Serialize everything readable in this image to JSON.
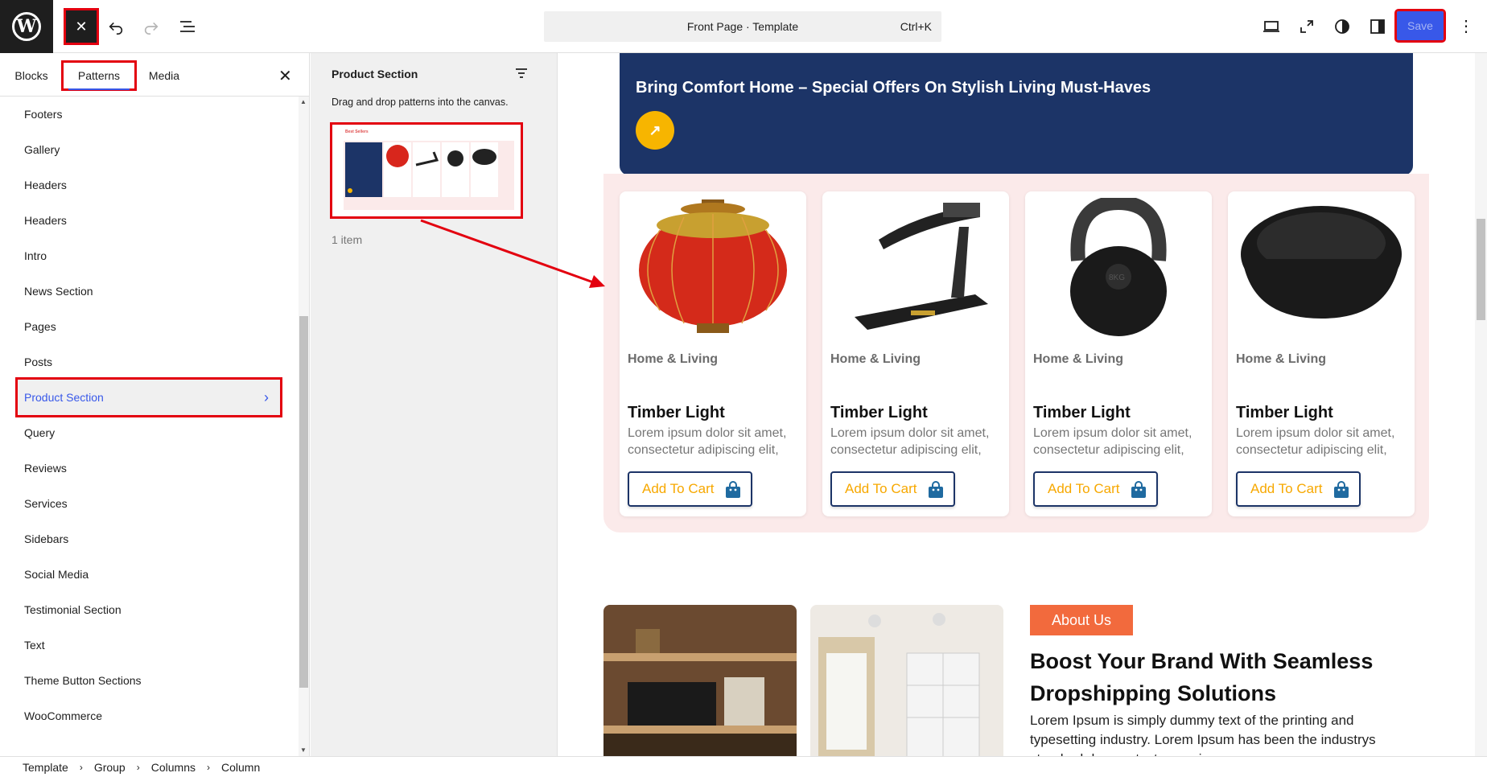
{
  "topbar": {
    "doc_title": "Front Page · Template",
    "shortcut": "Ctrl+K",
    "save_label": "Save",
    "icons": [
      "wordpress-icon",
      "close-icon",
      "undo-icon",
      "redo-icon",
      "list-view-icon",
      "desktop-icon",
      "fullscreen-icon",
      "styles-icon",
      "sidebar-icon",
      "more-icon"
    ]
  },
  "inserter": {
    "tabs": [
      {
        "label": "Blocks"
      },
      {
        "label": "Patterns"
      },
      {
        "label": "Media"
      }
    ],
    "active_tab": "Patterns",
    "categories": [
      {
        "label": "Footers"
      },
      {
        "label": "Gallery"
      },
      {
        "label": "Headers"
      },
      {
        "label": "Headers"
      },
      {
        "label": "Intro"
      },
      {
        "label": "News Section"
      },
      {
        "label": "Pages"
      },
      {
        "label": "Posts"
      },
      {
        "label": "Product Section"
      },
      {
        "label": "Query"
      },
      {
        "label": "Reviews"
      },
      {
        "label": "Services"
      },
      {
        "label": "Sidebars"
      },
      {
        "label": "Social Media"
      },
      {
        "label": "Testimonial Section"
      },
      {
        "label": "Text"
      },
      {
        "label": "Theme Button Sections"
      },
      {
        "label": "WooCommerce"
      }
    ],
    "selected_category": "Product Section"
  },
  "patterns": {
    "title": "Product Section",
    "description": "Drag and drop patterns into the canvas.",
    "count": "1 item"
  },
  "canvas": {
    "banner_title": "Bring Comfort Home – Special Offers On Stylish Living Must-Haves",
    "products": [
      {
        "category": "Home & Living",
        "name": "Timber Light",
        "desc": "Lorem ipsum dolor sit amet, consectetur adipiscing elit,",
        "button": "Add To Cart",
        "image": "red-lantern"
      },
      {
        "category": "Home & Living",
        "name": "Timber Light",
        "desc": "Lorem ipsum dolor sit amet, consectetur adipiscing elit,",
        "button": "Add To Cart",
        "image": "treadmill"
      },
      {
        "category": "Home & Living",
        "name": "Timber Light",
        "desc": "Lorem ipsum dolor sit amet, consectetur adipiscing elit,",
        "button": "Add To Cart",
        "image": "kettlebell"
      },
      {
        "category": "Home & Living",
        "name": "Timber Light",
        "desc": "Lorem ipsum dolor sit amet, consectetur adipiscing elit,",
        "button": "Add To Cart",
        "image": "pet-bowl"
      }
    ],
    "about": {
      "badge": "About Us",
      "heading": "Boost Your Brand With Seamless Dropshipping Solutions",
      "body": "Lorem Ipsum is simply dummy text of the printing and typesetting industry. Lorem Ipsum has been the industrys standard dummy text ever since"
    }
  },
  "breadcrumb": [
    {
      "label": "Template"
    },
    {
      "label": "Group"
    },
    {
      "label": "Columns"
    },
    {
      "label": "Column"
    }
  ],
  "colors": {
    "accent": "#3858e9",
    "highlight": "#e3000f",
    "banner": "#1c3467",
    "cta": "#f7b500",
    "about_badge": "#f26a3d"
  }
}
